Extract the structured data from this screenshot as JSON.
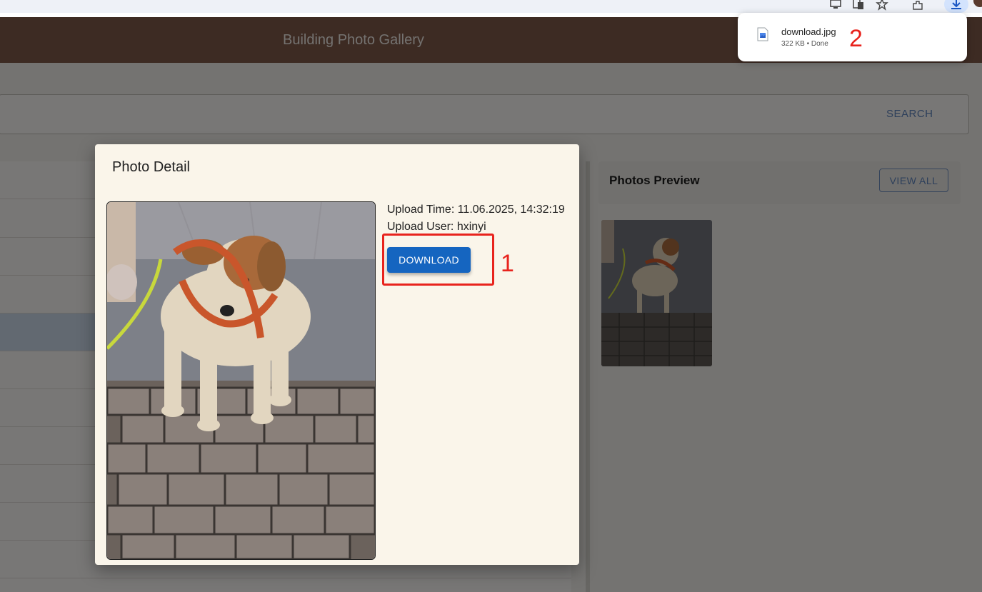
{
  "app": {
    "title": "Building Photo Gallery",
    "search_button": "SEARCH"
  },
  "preview": {
    "title": "Photos Preview",
    "view_all_button": "VIEW ALL"
  },
  "dialog": {
    "title": "Photo Detail",
    "upload_time": "Upload Time: 11.06.2025, 14:32:19",
    "upload_user": "Upload User: hxinyi",
    "download_button": "DOWNLOAD"
  },
  "download_popup": {
    "file_name": "download.jpg",
    "status": "322 KB • Done"
  },
  "annotations": {
    "marker_1": "1",
    "marker_2": "2"
  },
  "colors": {
    "header": "#7a5647",
    "accent": "#1565c0",
    "annotation": "#e8231d",
    "dialog_bg": "#faf5ea"
  },
  "icons": [
    "monitor-icon",
    "translate-icon",
    "star-icon",
    "extensions-icon",
    "download-icon",
    "file-image-icon"
  ]
}
